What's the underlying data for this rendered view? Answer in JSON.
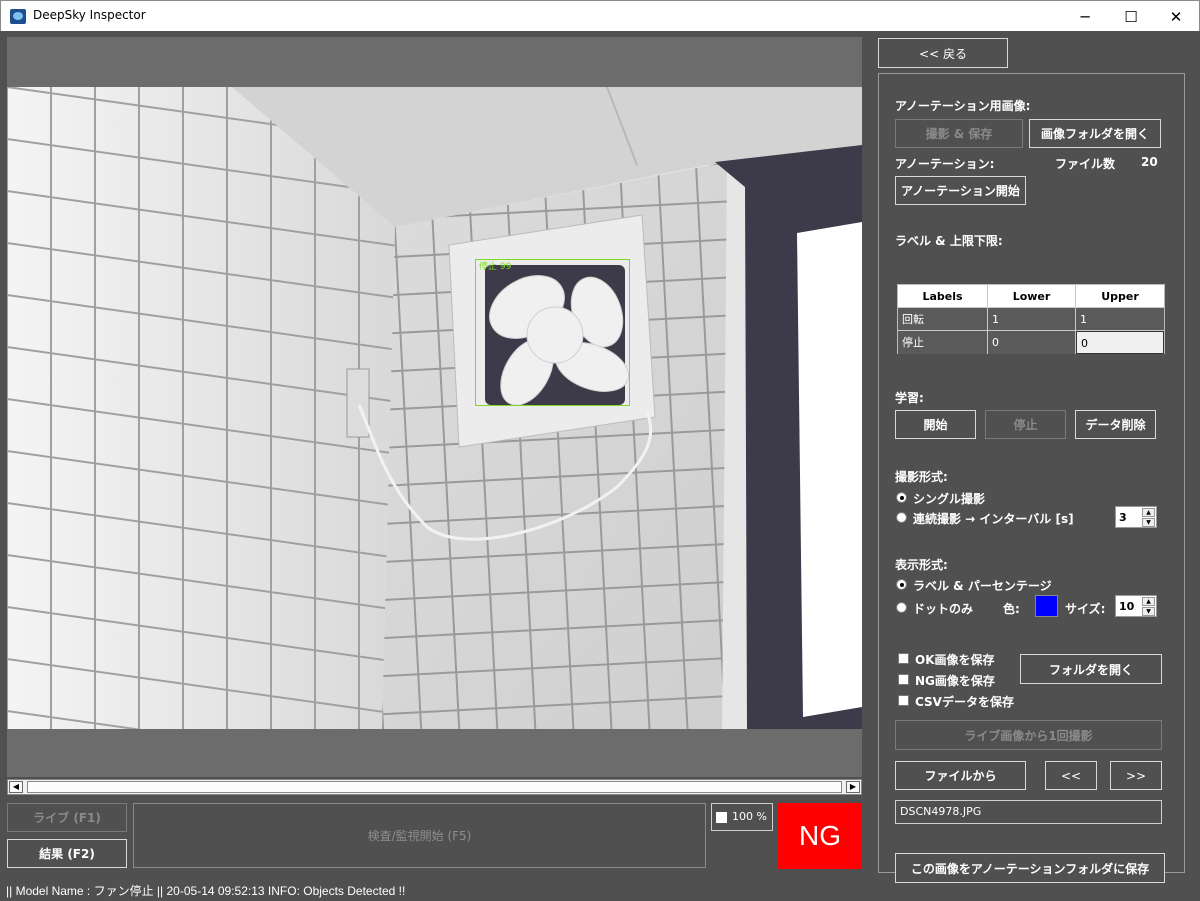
{
  "window": {
    "title": "DeepSky Inspector",
    "minimize_glyph": "─",
    "maximize_glyph": "☐",
    "close_glyph": "✕"
  },
  "viewer": {
    "detection_label": "停止 99",
    "detection_color": "#7ddc1f",
    "scroll_left": "◀",
    "scroll_right": "▶"
  },
  "controls": {
    "live_label": "ライブ (F1)",
    "result_label": "結果 (F2)",
    "inspect_label": "検査/監視開始 (F5)",
    "zoom_label": "100 %",
    "judgement": "NG",
    "judgement_color": "#ff0000"
  },
  "status_bar": "|| Model Name : ファン停止 ||    20-05-14 09:52:13   INFO:   Objects Detected !!",
  "panel": {
    "back_label": "<< 戻る",
    "annotation_images_heading": "アノーテーション用画像:",
    "capture_save_label": "撮影 & 保存",
    "open_image_folder_label": "画像フォルダを開く",
    "annotation_heading": "アノーテーション:",
    "file_count_label": "ファイル数",
    "file_count_value": "20",
    "annotation_start_label": "アノーテーション開始",
    "label_limits_heading": "ラベル & 上限下限:",
    "table": {
      "headers": [
        "Labels",
        "Lower",
        "Upper"
      ],
      "rows": [
        [
          "回転",
          "1",
          "1"
        ],
        [
          "停止",
          "0",
          "0"
        ]
      ]
    },
    "learning_heading": "学習:",
    "learn_start_label": "開始",
    "learn_stop_label": "停止",
    "delete_data_label": "データ削除",
    "capture_mode_heading": "撮影形式:",
    "single_capture_label": "シングル撮影",
    "continuous_capture_label": "連続撮影 → インターバル [s]",
    "interval_value": "3",
    "display_mode_heading": "表示形式:",
    "label_percentage_label": "ラベル & パーセンテージ",
    "dots_only_label": "ドットのみ",
    "color_label": "色:",
    "dot_color": "#0000ff",
    "size_label": "サイズ:",
    "size_value": "10",
    "save_ok_label": "OK画像を保存",
    "save_ng_label": "NG画像を保存",
    "save_csv_label": "CSVデータを保存",
    "open_folder_label": "フォルダを開く",
    "capture_from_live_label": "ライブ画像から1回撮影",
    "from_file_label": "ファイルから",
    "prev_label": "<<",
    "next_label": ">>",
    "filename": "DSCN4978.JPG",
    "save_to_annotation_label": "この画像をアノーテーションフォルダに保存"
  }
}
